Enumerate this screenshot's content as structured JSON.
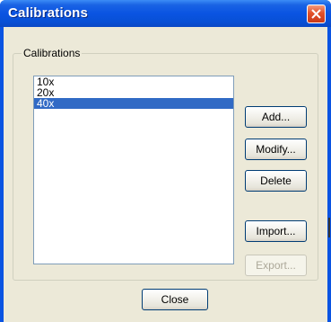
{
  "window": {
    "title": "Calibrations"
  },
  "group": {
    "legend": "Calibrations"
  },
  "list": {
    "items": [
      "10x",
      "20x",
      "40x"
    ],
    "selected_index": 2
  },
  "buttons": {
    "add": "Add...",
    "modify": "Modify...",
    "delete": "Delete",
    "import": "Import...",
    "export": "Export...",
    "close": "Close"
  },
  "colors": {
    "titlebar": "#0a54e2",
    "selection": "#316ac5",
    "client": "#ece9d8",
    "close_button": "#e2512a"
  },
  "icons": {
    "close": "close-x-icon"
  }
}
